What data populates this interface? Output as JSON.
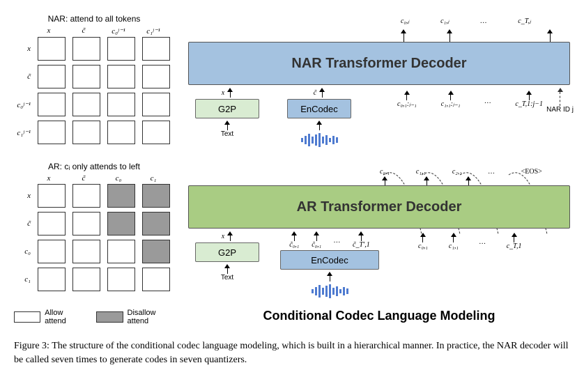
{
  "nar_matrix": {
    "title": "NAR:  attend to all tokens",
    "cols": [
      "x",
      "c̃",
      "c₀ʲ⁻¹",
      "c₁ʲ⁻¹"
    ],
    "rows": [
      "x",
      "c̃",
      "c₀ʲ⁻¹",
      "c₁ʲ⁻¹"
    ]
  },
  "ar_matrix": {
    "title": "AR:  cᵢ only attends to left",
    "cols": [
      "x",
      "c̃",
      "c₀",
      "c₁"
    ],
    "rows": [
      "x",
      "c̃",
      "c₀",
      "c₁"
    ]
  },
  "legend": {
    "allow": "Allow attend",
    "disallow": "Disallow attend"
  },
  "blocks": {
    "nar": "NAR Transformer Decoder",
    "ar": "AR Transformer Decoder",
    "g2p": "G2P",
    "encodec": "EnCodec",
    "text": "Text"
  },
  "nar_outputs": [
    "c₀,ⱼ",
    "c₁,ⱼ",
    "…",
    "c_T,ⱼ"
  ],
  "nar_inputs_right": [
    "c₀,₁:ⱼ₋₁",
    "c₁,₁:ⱼ₋₁",
    "…",
    "c_T,1:j−1"
  ],
  "nar_id_label": "NAR ID j",
  "ar_outputs": [
    "c₀,₁",
    "c₁,₁",
    "c₂,₁",
    "…",
    "<EOS>"
  ],
  "ar_inputs_right": [
    "c̃₀,₁",
    "c̃₀,₁",
    "…",
    "c̃_T′,1",
    "c₀,₁",
    "c₁,₁",
    "…",
    "c_T,1"
  ],
  "x_label": "x",
  "c_tilde_label": "c̃",
  "main_title": "Conditional Codec Language Modeling",
  "caption": "Figure 3: The structure of the conditional codec language modeling, which is built in a hierarchical manner. In practice, the NAR decoder will be called seven times to generate codes in seven quantizers."
}
